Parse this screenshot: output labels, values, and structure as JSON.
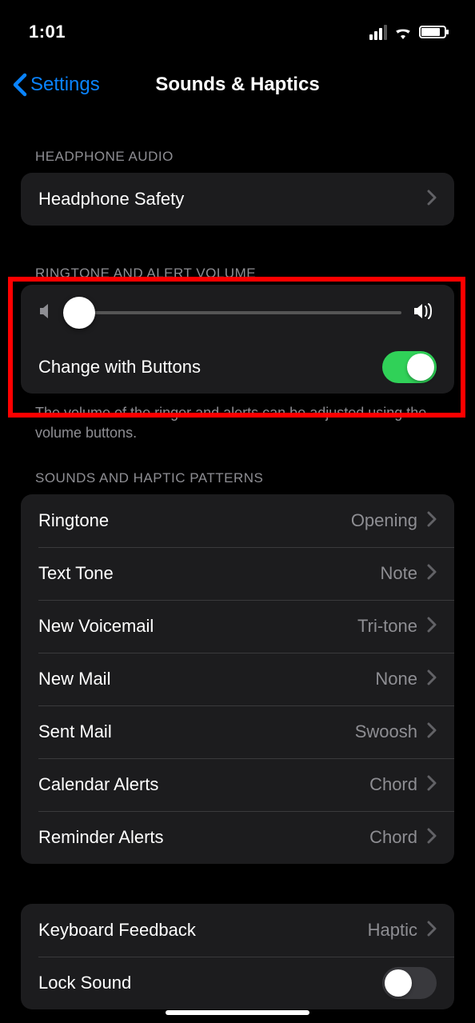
{
  "status": {
    "time": "1:01"
  },
  "nav": {
    "back_label": "Settings",
    "title": "Sounds & Haptics"
  },
  "headphone": {
    "header": "HEADPHONE AUDIO",
    "safety_label": "Headphone Safety"
  },
  "ringtone_volume": {
    "header": "RINGTONE AND ALERT VOLUME",
    "change_label": "Change with Buttons",
    "change_on": true,
    "slider_percent": 4,
    "footer": "The volume of the ringer and alerts can be adjusted using the volume buttons."
  },
  "patterns": {
    "header": "SOUNDS AND HAPTIC PATTERNS",
    "items": [
      {
        "label": "Ringtone",
        "value": "Opening"
      },
      {
        "label": "Text Tone",
        "value": "Note"
      },
      {
        "label": "New Voicemail",
        "value": "Tri-tone"
      },
      {
        "label": "New Mail",
        "value": "None"
      },
      {
        "label": "Sent Mail",
        "value": "Swoosh"
      },
      {
        "label": "Calendar Alerts",
        "value": "Chord"
      },
      {
        "label": "Reminder Alerts",
        "value": "Chord"
      }
    ]
  },
  "system": {
    "keyboard_label": "Keyboard Feedback",
    "keyboard_value": "Haptic",
    "lock_label": "Lock Sound",
    "lock_on": false
  }
}
